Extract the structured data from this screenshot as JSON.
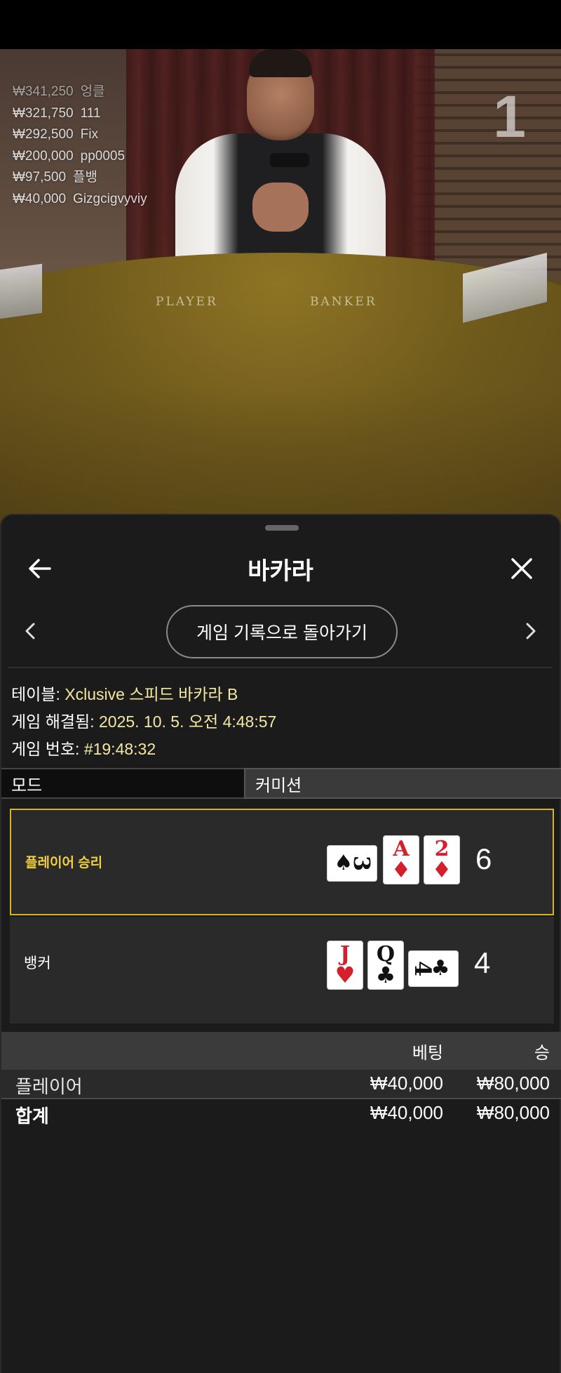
{
  "video": {
    "table_labels": {
      "player": "PLAYER",
      "banker": "BANKER"
    },
    "round_number": "1",
    "winners": [
      {
        "amount": "₩341,250",
        "name": "엉클"
      },
      {
        "amount": "₩321,750",
        "name": "111"
      },
      {
        "amount": "₩292,500",
        "name": "Fix"
      },
      {
        "amount": "₩200,000",
        "name": "pp0005"
      },
      {
        "amount": "₩97,500",
        "name": "플뱅"
      },
      {
        "amount": "₩40,000",
        "name": "Gizgcigvyviy"
      }
    ]
  },
  "sheet": {
    "title": "바카라",
    "back_to_history": "게임 기록으로 돌아가기",
    "info": {
      "table_label": "테이블:",
      "table_value": "Xclusive 스피드 바카라 B",
      "resolved_label": "게임 해결됨:",
      "resolved_value": "2025. 10. 5. 오전 4:48:57",
      "game_no_label": "게임 번호:",
      "game_no_value": "#19:48:32"
    },
    "tabs": {
      "mode": "모드",
      "commission": "커미션"
    },
    "player_hand": {
      "label": "플레이어 승리",
      "total": "6",
      "cards": [
        {
          "rank": "3",
          "suit": "♠",
          "color": "#111111",
          "orientation": "sideways"
        },
        {
          "rank": "A",
          "suit": "♦",
          "color": "#d4202a",
          "orientation": "upright"
        },
        {
          "rank": "2",
          "suit": "♦",
          "color": "#d4202a",
          "orientation": "upright"
        }
      ]
    },
    "banker_hand": {
      "label": "뱅커",
      "total": "4",
      "cards": [
        {
          "rank": "J",
          "suit": "♥",
          "color": "#d4202a",
          "orientation": "upright"
        },
        {
          "rank": "Q",
          "suit": "♣",
          "color": "#111111",
          "orientation": "upright"
        },
        {
          "rank": "4",
          "suit": "♣",
          "color": "#111111",
          "orientation": "sideways"
        }
      ]
    },
    "bets_table": {
      "headers": {
        "bet": "베팅",
        "win": "승"
      },
      "rows": [
        {
          "label": "플레이어",
          "bet": "₩40,000",
          "win": "₩80,000"
        }
      ],
      "total": {
        "label": "합계",
        "bet": "₩40,000",
        "win": "₩80,000"
      }
    },
    "accent_color": "#d4b52a"
  }
}
